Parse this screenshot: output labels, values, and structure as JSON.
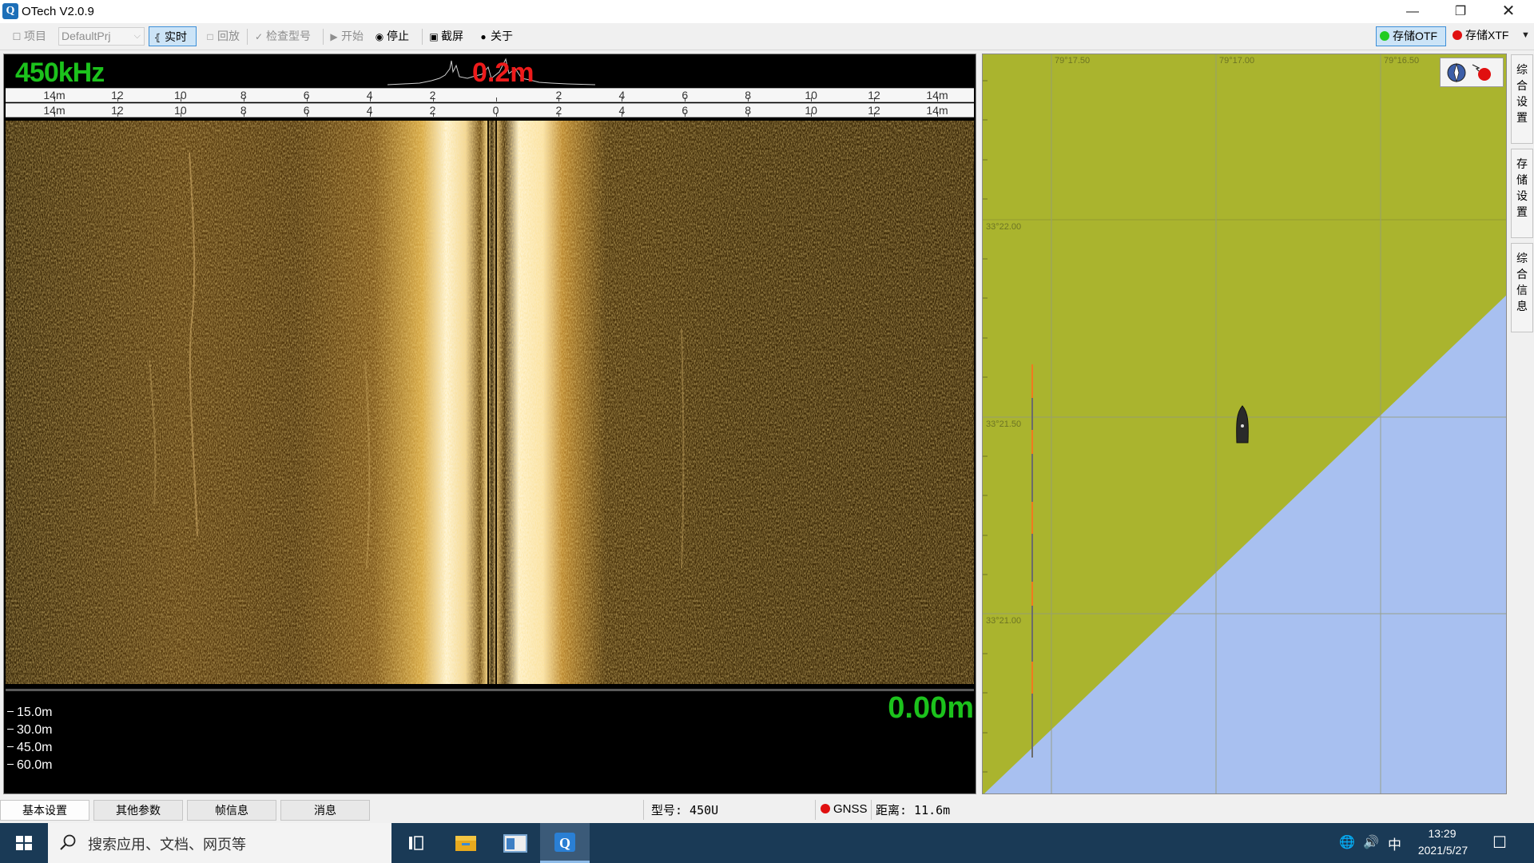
{
  "window": {
    "title": "OTech V2.0.9",
    "app_icon": "otech-logo-icon"
  },
  "toolbar": {
    "project_label": "项目",
    "project_value": "DefaultPrj",
    "realtime_label": "实时",
    "playback_label": "回放",
    "check_model_label": "检查型号",
    "start_label": "开始",
    "stop_label": "停止",
    "screenshot_label": "截屏",
    "about_label": "关于",
    "store_otf_label": "存储OTF",
    "store_xtf_label": "存储XTF",
    "colors": {
      "otf_dot": "#22cc22",
      "xtf_dot": "#e01010"
    }
  },
  "sonar": {
    "frequency": "450kHz",
    "range_value": "0.2m",
    "scale_top": [
      "14m",
      "12",
      "10",
      "8",
      "6",
      "4",
      "2",
      "",
      "2",
      "4",
      "6",
      "8",
      "10",
      "12",
      "14m"
    ],
    "scale_bottom": [
      "14m",
      "12",
      "10",
      "8",
      "6",
      "4",
      "2",
      "0",
      "2",
      "4",
      "6",
      "8",
      "10",
      "12",
      "14m"
    ],
    "depth_ticks": [
      "15.0m",
      "30.0m",
      "45.0m",
      "60.0m"
    ],
    "altitude_value": "0.00m",
    "colors": {
      "frequency": "#1cc21c",
      "range": "#ee1b1b",
      "altitude": "#1cc21c"
    }
  },
  "map": {
    "longitude_labels": [
      "79°17.50",
      "79°17.00",
      "79°16.50"
    ],
    "latitude_labels": [
      "33°22.00",
      "33°21.50",
      "33°21.00"
    ],
    "colors": {
      "land": "#aab42e",
      "water": "#a8c0f0"
    },
    "vessel_icon": "boat-icon",
    "compass_icon": "compass-icon",
    "record_icon": "record-icon"
  },
  "side_tabs": [
    {
      "label": "综\n合\n设\n置"
    },
    {
      "label": "存\n储\n设\n置"
    },
    {
      "label": "综\n合\n信\n息"
    }
  ],
  "bottom_tabs": [
    "基本设置",
    "其他参数",
    "帧信息",
    "消息"
  ],
  "status": {
    "model": "型号: 450U",
    "gnss_label": "GNSS",
    "distance": "距离: 11.6m",
    "gnss_dot_color": "#e01010"
  },
  "taskbar": {
    "search_placeholder": "搜索应用、文档、网页等",
    "time": "13:29",
    "date": "2021/5/27",
    "ime": "中"
  }
}
